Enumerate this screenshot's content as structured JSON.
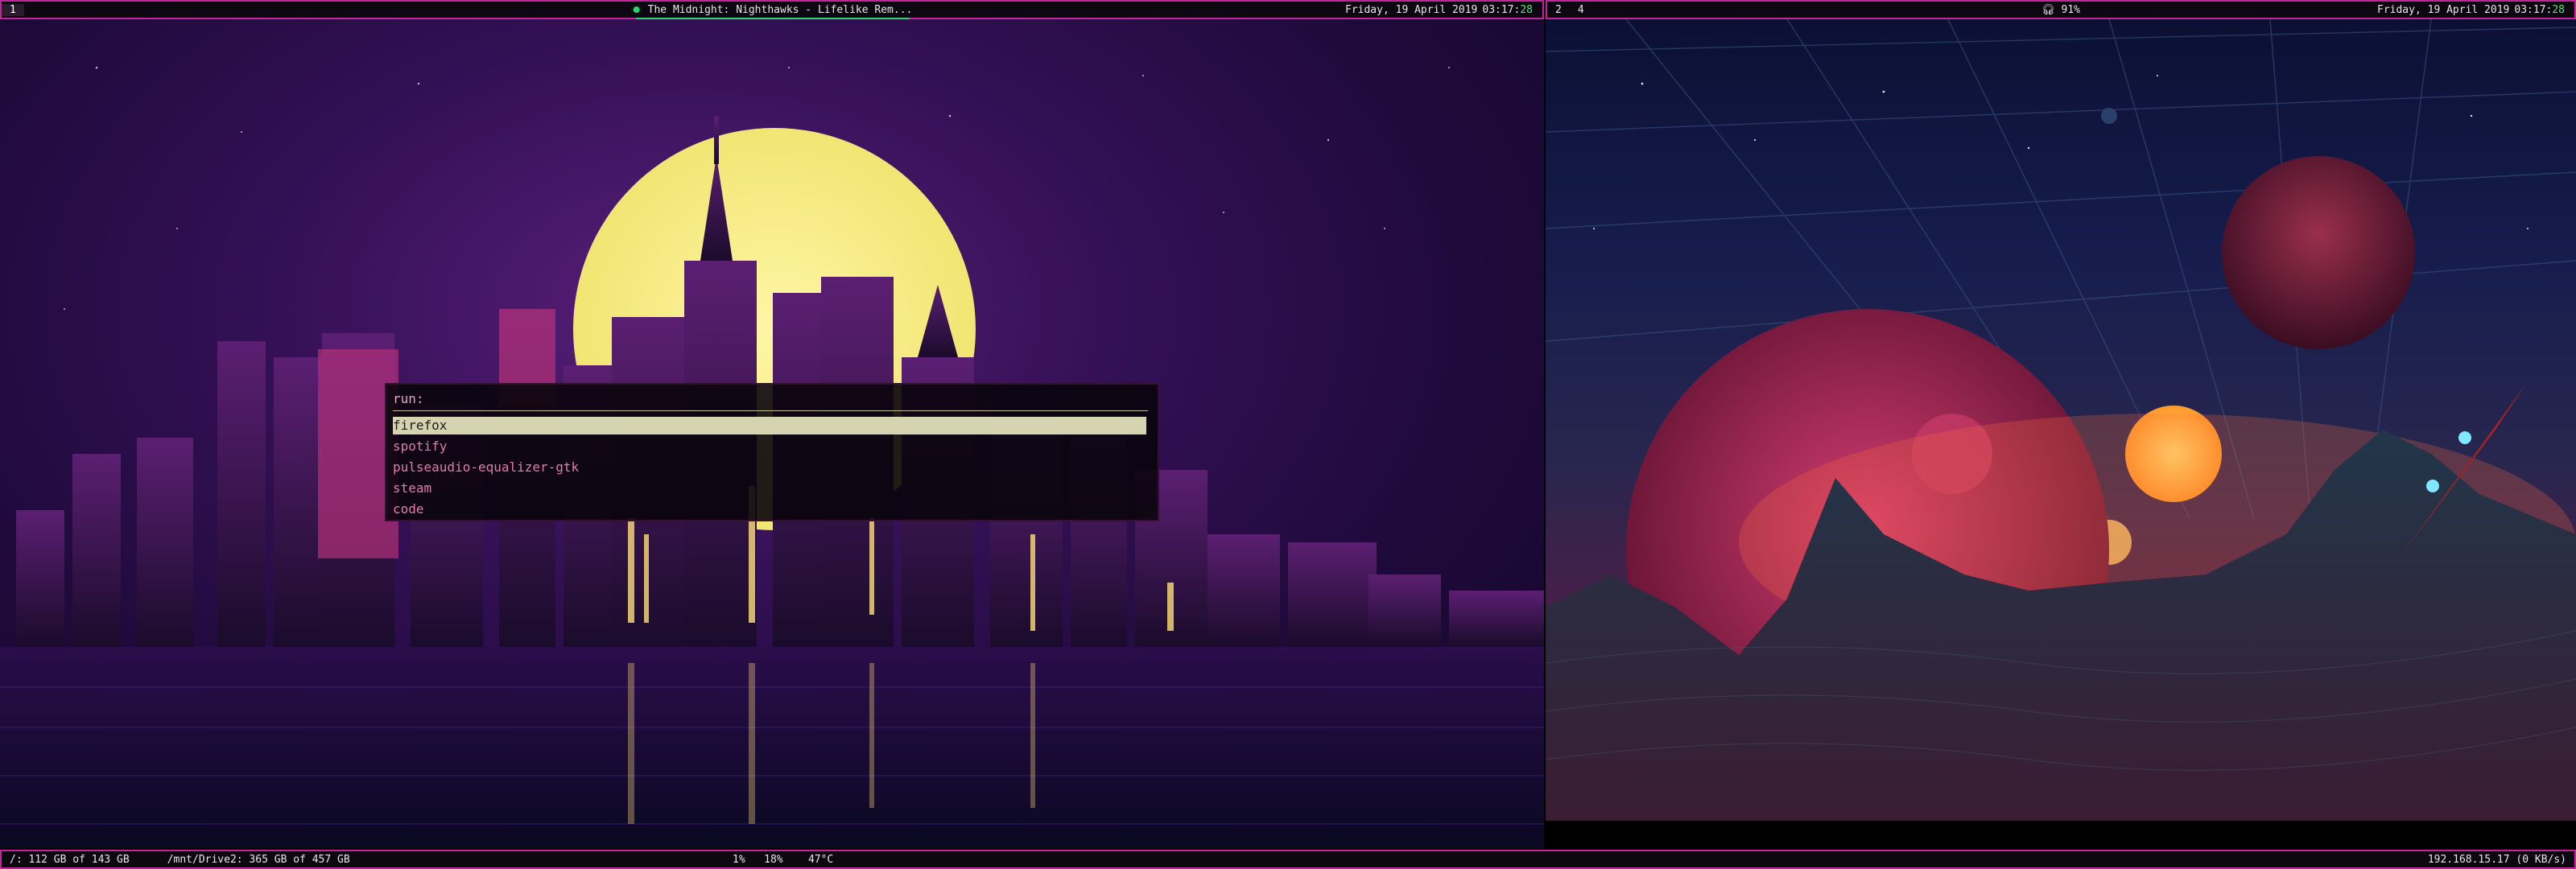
{
  "colors": {
    "accent": "#c4249a",
    "good": "#33d26f",
    "run_text": "#e17ca5",
    "selection": "#d6d4b0"
  },
  "left_bar": {
    "workspace": "1",
    "media_icon": "green-dot-icon",
    "title": "The Midnight: Nighthawks - Lifelike Rem...",
    "date": "Friday, 19 April 2019",
    "time": "03:17:",
    "seconds": "28"
  },
  "right_bar": {
    "workspaces": [
      "2",
      "4"
    ],
    "volume_icon": "headphones-icon",
    "volume": "91%",
    "date": "Friday, 19 April 2019",
    "time": "03:17:",
    "seconds": "28"
  },
  "run_menu": {
    "prompt": "run:",
    "items": [
      "firefox",
      "spotify",
      "pulseaudio-equalizer-gtk",
      "steam",
      "code"
    ],
    "selected_index": 0
  },
  "bottom_bar": {
    "disk1": "/: 112 GB of 143 GB",
    "disk2": "/mnt/Drive2: 365 GB of 457 GB",
    "cpu": "1%",
    "mem": "18%",
    "temp": "47°C",
    "net": "192.168.15.17 (0 KB/s)"
  }
}
